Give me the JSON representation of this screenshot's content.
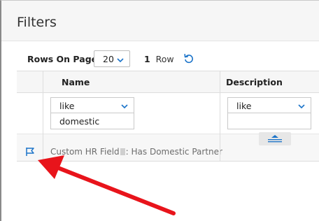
{
  "dialog": {
    "title": "Filters"
  },
  "toolbar": {
    "rows_on_page_label": "Rows On Page",
    "rows_on_page_value": "20",
    "row_count_number": "1",
    "row_count_label": "Row",
    "refresh_icon": "refresh-icon"
  },
  "table": {
    "columns": [
      {
        "name": "Name"
      },
      {
        "name": "Description"
      }
    ],
    "filters": {
      "name_operator": "like",
      "name_value": "domestic",
      "description_operator": "like",
      "description_value": ""
    },
    "rows": [
      {
        "name_prefix": "Custom HR Field",
        "name_suffix": ": Has Domestic Partner",
        "description": ""
      }
    ]
  },
  "colors": {
    "accent": "#1a73c9",
    "annotation_arrow": "#e8141b"
  }
}
